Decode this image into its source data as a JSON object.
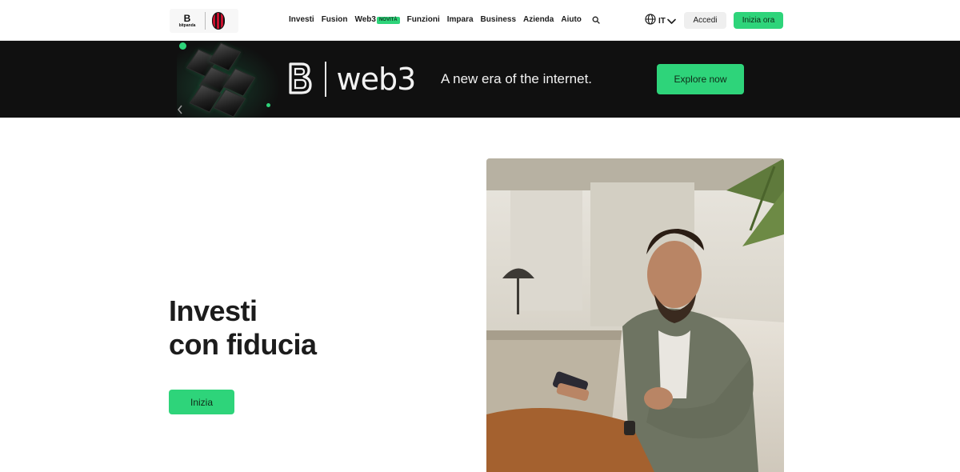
{
  "header": {
    "logo": {
      "brand_mark": "B",
      "brand_text": "bitpanda"
    },
    "nav": [
      {
        "label": "Investi"
      },
      {
        "label": "Fusion"
      },
      {
        "label": "Web3",
        "badge": "NOVITÀ"
      },
      {
        "label": "Funzioni"
      },
      {
        "label": "Impara"
      },
      {
        "label": "Business"
      },
      {
        "label": "Azienda"
      },
      {
        "label": "Aiuto"
      }
    ],
    "search_icon": "search-icon",
    "language": {
      "label": "IT",
      "icon": "globe-icon"
    },
    "login_label": "Accedi",
    "start_label": "Inizia ora"
  },
  "banner": {
    "logo_text": "web3",
    "tagline": "A new era of the internet.",
    "cta_label": "Explore now"
  },
  "hero": {
    "title_line1": "Investi",
    "title_line2": "con fiducia",
    "cta_label": "Inizia"
  },
  "colors": {
    "accent": "#2ed47a",
    "banner_bg": "#101010",
    "text": "#1c1c1c"
  }
}
